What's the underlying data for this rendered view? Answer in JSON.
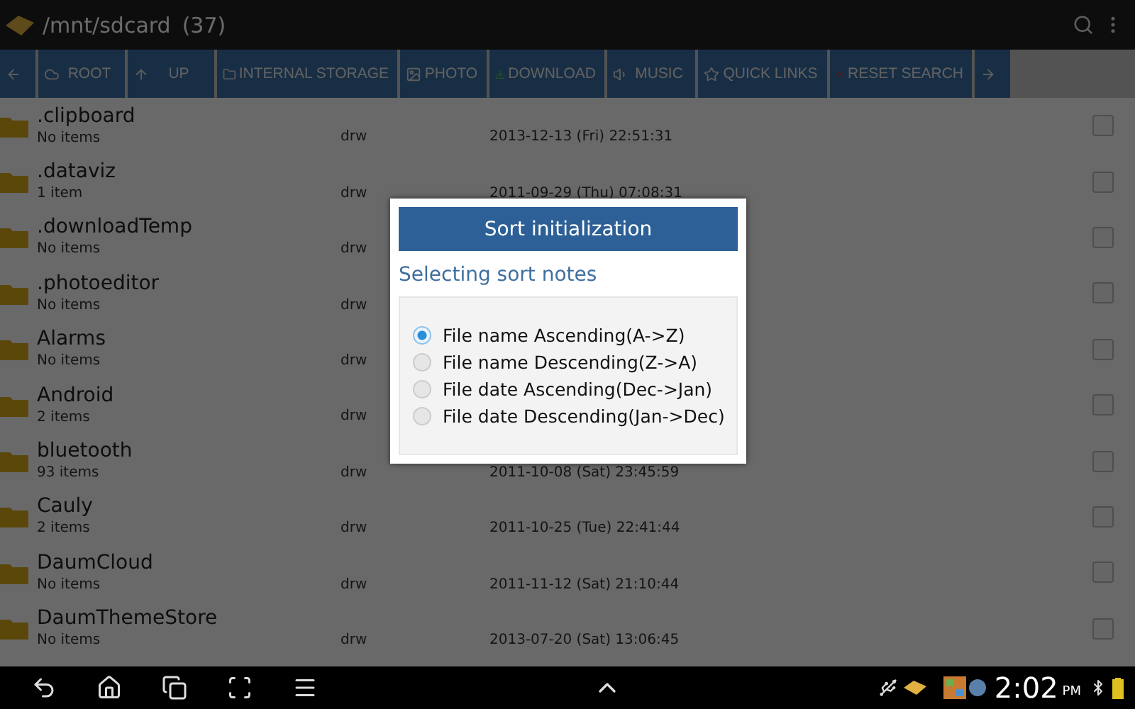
{
  "header": {
    "title": "/mnt/sdcard",
    "count": "(37)"
  },
  "toolbar": [
    {
      "kind": "back"
    },
    {
      "kind": "root",
      "label": "ROOT"
    },
    {
      "kind": "up",
      "label": "UP"
    },
    {
      "kind": "storage",
      "label": "INTERNAL STORAGE"
    },
    {
      "kind": "photo",
      "label": "PHOTO"
    },
    {
      "kind": "download",
      "label": "DOWNLOAD"
    },
    {
      "kind": "music",
      "label": "MUSIC"
    },
    {
      "kind": "links",
      "label": "QUICK LINKS"
    },
    {
      "kind": "reset",
      "label": "RESET SEARCH"
    },
    {
      "kind": "forward"
    }
  ],
  "files": [
    {
      "name": ".clipboard",
      "info": "No items",
      "perm": "drw",
      "date": "2013-12-13 (Fri) 22:51:31",
      "checked": false
    },
    {
      "name": ".dataviz",
      "info": "1 item",
      "perm": "drw",
      "date": "2011-09-29 (Thu) 07:08:31",
      "checked": false
    },
    {
      "name": ".downloadTemp",
      "info": "No items",
      "perm": "drw",
      "checked": false
    },
    {
      "name": ".photoeditor",
      "info": "No items",
      "perm": "drw",
      "checked": false
    },
    {
      "name": "Alarms",
      "info": "No items",
      "perm": "drw",
      "checked": false
    },
    {
      "name": "Android",
      "info": "2 items",
      "perm": "drw",
      "checked": false
    },
    {
      "name": "bluetooth",
      "info": "93 items",
      "perm": "drw",
      "date": "2011-10-08 (Sat) 23:45:59",
      "checked": false
    },
    {
      "name": "Cauly",
      "info": "2 items",
      "perm": "drw",
      "date": "2011-10-25 (Tue) 22:41:44",
      "checked": false
    },
    {
      "name": "DaumCloud",
      "info": "No items",
      "perm": "drw",
      "date": "2011-11-12 (Sat) 21:10:44",
      "checked": false
    },
    {
      "name": "DaumThemeStore",
      "info": "No items",
      "perm": "drw",
      "date": "2013-07-20 (Sat) 13:06:45",
      "checked": false
    }
  ],
  "dialog": {
    "button": "Sort initialization",
    "subtitle": "Selecting sort notes",
    "options": [
      {
        "label": "File name Ascending(A->Z)",
        "selected": true
      },
      {
        "label": "File name Descending(Z->A)",
        "selected": false
      },
      {
        "label": "File date Ascending(Dec->Jan)",
        "selected": false
      },
      {
        "label": "File date Descending(Jan->Dec)",
        "selected": false
      }
    ]
  },
  "system_bar": {
    "time": "2:02",
    "ampm": "PM"
  }
}
